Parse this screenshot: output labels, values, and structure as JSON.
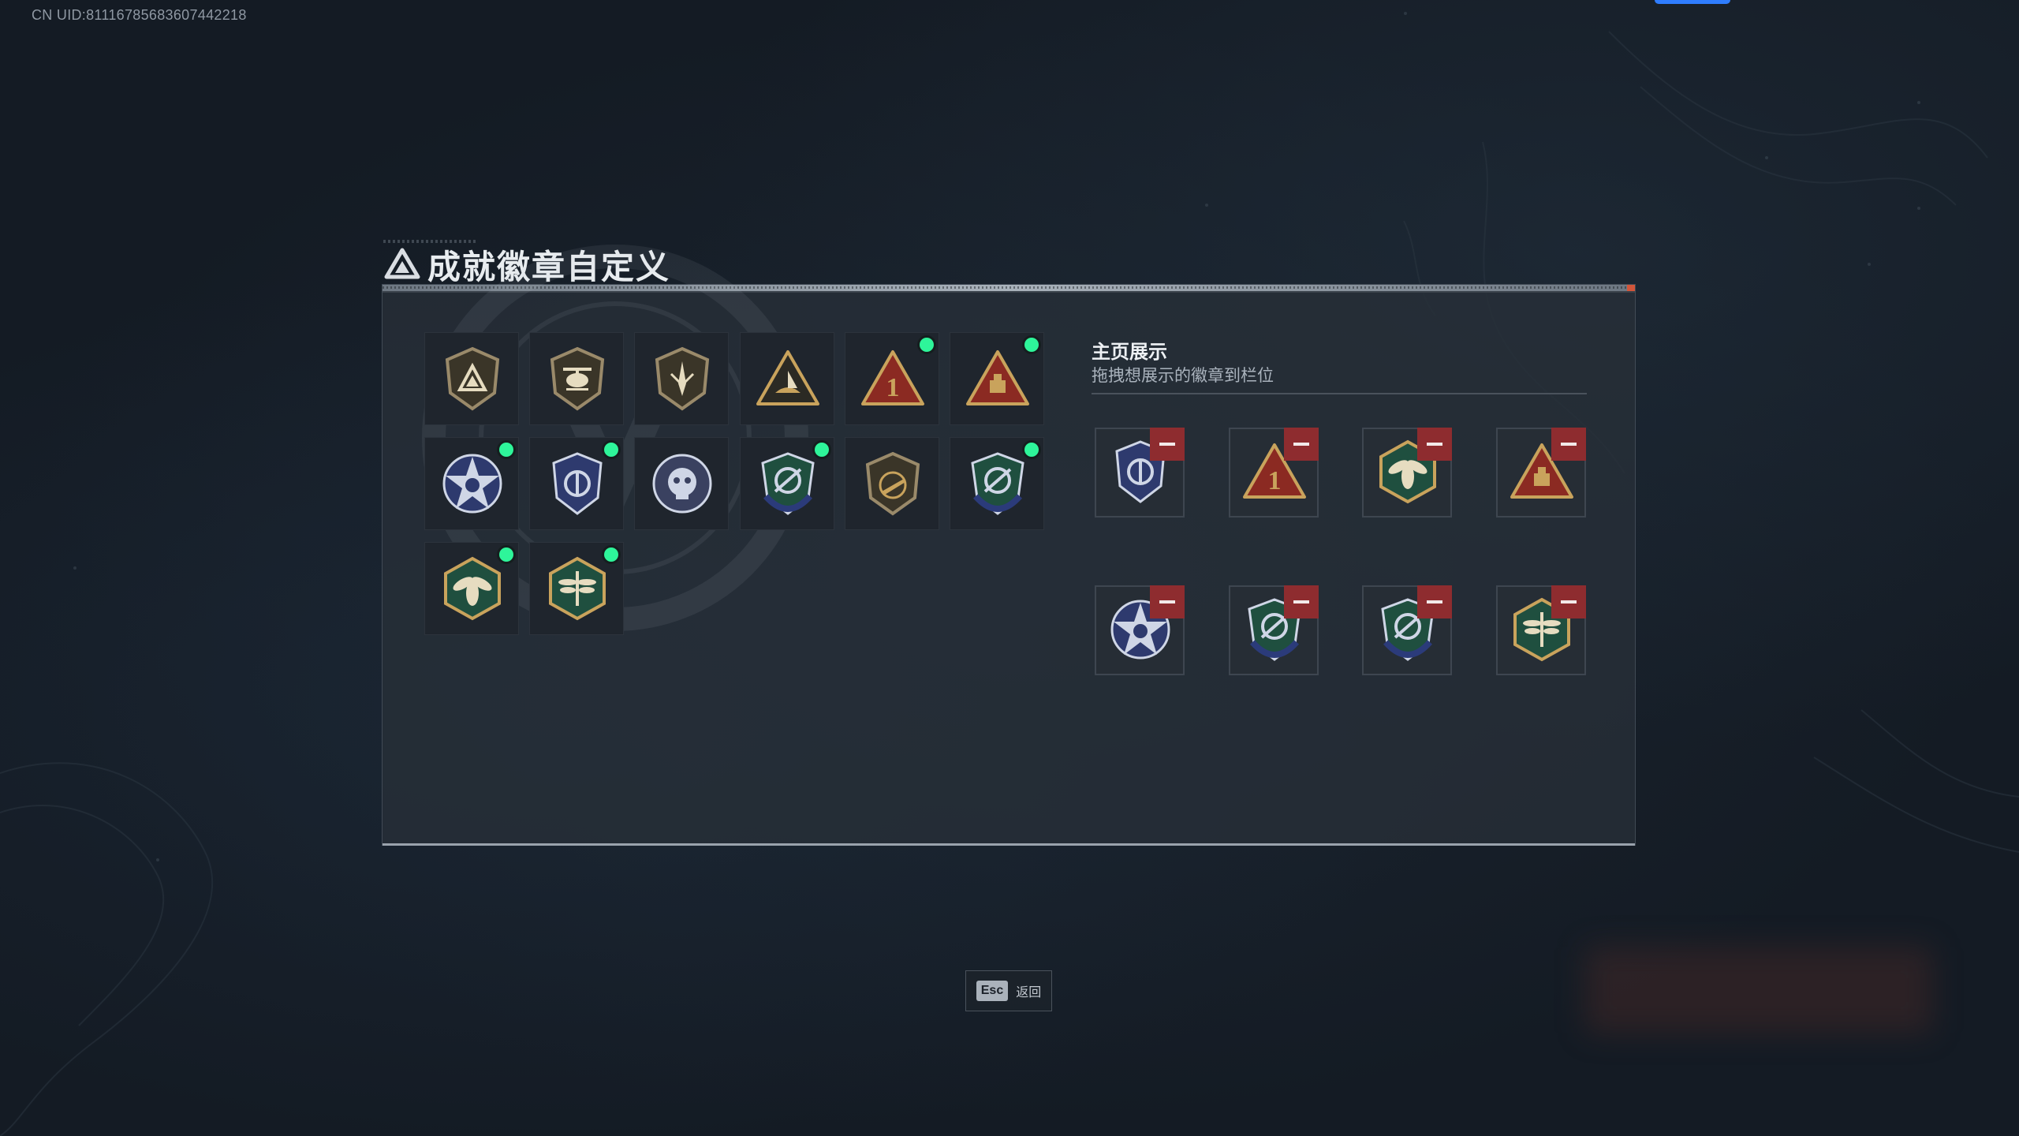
{
  "uid_text": "CN UID:81116785683607442218",
  "title": "成就徽章自定义",
  "right": {
    "heading": "主页展示",
    "subheading": "拖拽想展示的徽章到栏位"
  },
  "esc": {
    "key": "Esc",
    "label": "返回"
  },
  "colors": {
    "accent_new": "#2ef59a",
    "remove": "#8e2c2f",
    "top_button": "#2f7dff"
  },
  "badges": [
    {
      "icon": "bronze-shield-triangle-badge",
      "new": false
    },
    {
      "icon": "bronze-helicopter-badge",
      "new": false
    },
    {
      "icon": "bronze-dagger-badge",
      "new": false
    },
    {
      "icon": "gold-triangle-boat-badge",
      "new": false
    },
    {
      "icon": "red-triangle-one-badge",
      "new": true
    },
    {
      "icon": "red-triangle-box-badge",
      "new": true
    },
    {
      "icon": "blue-star-badge",
      "new": true
    },
    {
      "icon": "blue-shield-emblem-badge",
      "new": true
    },
    {
      "icon": "blue-skull-badge",
      "new": false
    },
    {
      "icon": "green-shield-crosshair-badge",
      "new": true
    },
    {
      "icon": "bronze-rifle-badge",
      "new": false
    },
    {
      "icon": "green-shield-crosshair-badge-2",
      "new": true
    },
    {
      "icon": "green-wasp-badge",
      "new": true
    },
    {
      "icon": "green-dragonfly-badge",
      "new": true
    }
  ],
  "display": [
    {
      "icon": "blue-shield-emblem-badge"
    },
    {
      "icon": "red-triangle-one-badge"
    },
    {
      "icon": "green-wasp-badge"
    },
    {
      "icon": "red-triangle-box-badge"
    },
    {
      "icon": "blue-star-badge"
    },
    {
      "icon": "green-shield-crosshair-badge"
    },
    {
      "icon": "green-shield-crosshair-badge-2"
    },
    {
      "icon": "green-dragonfly-badge"
    }
  ]
}
